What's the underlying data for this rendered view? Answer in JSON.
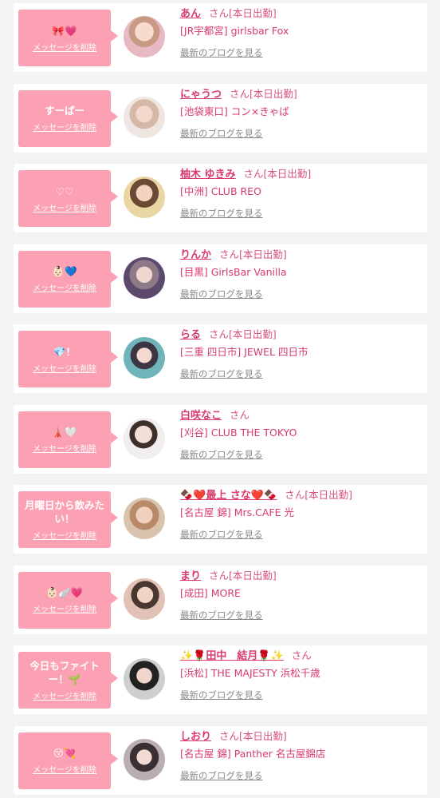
{
  "delete_label": "メッセージを削除",
  "san_label": "さん",
  "blog_label": "最新のブログを見る",
  "colors": {
    "bubble": "#fca0b4",
    "name": "#d83a6c",
    "link_gray": "#8a8a8a"
  },
  "cards": [
    {
      "message": "🎀💗",
      "name": "あん",
      "status": "[本日出勤]",
      "shop": "[JR宇都宮] girlsbar Fox"
    },
    {
      "message": "すーぱー",
      "name": "にゃうつ",
      "status": "[本日出勤]",
      "shop": "[池袋東口] コン×きゃば"
    },
    {
      "message": "♡♡",
      "name": "柚木 ゆきみ",
      "status": "[本日出勤]",
      "shop": "[中洲] CLUB REO"
    },
    {
      "message": "👶🏻💙",
      "name": "りんか",
      "status": "[本日出勤]",
      "shop": "[目黒] GirlsBar Vanilla"
    },
    {
      "message": "💎！",
      "name": "らる",
      "status": "[本日出勤]",
      "shop": "[三重 四日市] JEWEL 四日市"
    },
    {
      "message": "🗼🤍",
      "name": "白咲なこ",
      "status": "",
      "shop": "[刈谷] CLUB THE TOKYO"
    },
    {
      "message": "月曜日から飲みたい！",
      "name": "🍫❤️最上 さな❤️🍫",
      "status": "[本日出勤]",
      "shop": "[名古屋 錦] Mrs.CAFE 光"
    },
    {
      "message": "👶🏻🪽💗",
      "name": "まり",
      "status": "[本日出勤]",
      "shop": "[成田] MORE"
    },
    {
      "message": "今日もファイトー！🌱",
      "name": "✨🌹田中　結月🌹✨",
      "status": "",
      "shop": "[浜松] THE MAJESTY 浜松千歳"
    },
    {
      "message": "😚💘",
      "name": "しおり",
      "status": "[本日出勤]",
      "shop": "[名古屋 錦] Panther 名古屋錦店"
    }
  ]
}
